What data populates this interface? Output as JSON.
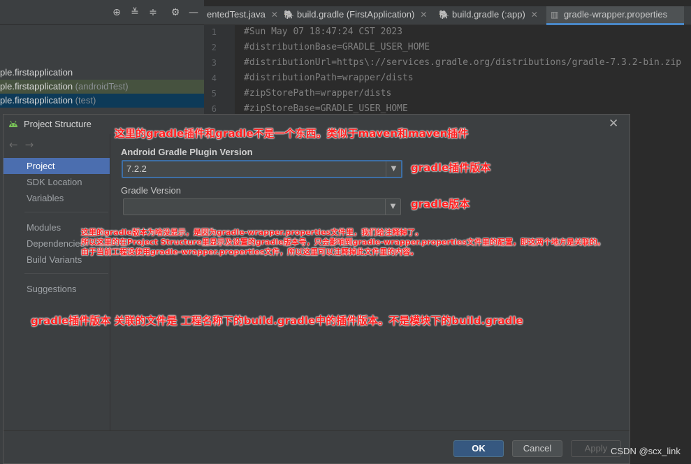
{
  "ide": {
    "toolbar_icons": [
      "crosshair-icon",
      "expand-all-icon",
      "collapse-all-icon",
      "gear-icon",
      "minimize-icon"
    ],
    "tree_rows": [
      {
        "main": "ple.firstapplication",
        "suffix": ""
      },
      {
        "main": "ple.firstapplication",
        "suffix": " (androidTest)"
      },
      {
        "main": "ple.firstapplication",
        "suffix": " (test)"
      }
    ],
    "tabs": [
      {
        "label": "entedTest.java"
      },
      {
        "label": "build.gradle (FirstApplication)"
      },
      {
        "label": "build.gradle (:app)"
      },
      {
        "label": "gradle-wrapper.properties"
      }
    ],
    "editor_lines": [
      {
        "no": "1",
        "text": "#Sun May 07 18:47:24 CST 2023"
      },
      {
        "no": "2",
        "text": "#distributionBase=GRADLE_USER_HOME"
      },
      {
        "no": "3",
        "text": "#distributionUrl=https\\://services.gradle.org/distributions/gradle-7.3.2-bin.zip"
      },
      {
        "no": "4",
        "text": "#distributionPath=wrapper/dists"
      },
      {
        "no": "5",
        "text": "#zipStorePath=wrapper/dists"
      },
      {
        "no": "6",
        "text": "#zipStoreBase=GRADLE_USER_HOME"
      }
    ]
  },
  "dialog": {
    "title": "Project Structure",
    "nav": {
      "items": [
        "Project",
        "SDK Location",
        "Variables",
        "Modules",
        "Dependencies",
        "Build Variants",
        "Suggestions"
      ],
      "selected": "Project"
    },
    "agp_label": "Android Gradle Plugin Version",
    "agp_value": "7.2.2",
    "gradle_label": "Gradle Version",
    "gradle_value": "",
    "buttons": {
      "ok": "OK",
      "cancel": "Cancel",
      "apply": "Apply"
    }
  },
  "annotations": {
    "title_note": "这里的gradle插件和gradle不是一个东西。类似于maven和maven插件",
    "agp_note": "gradle插件版本",
    "gradle_note": "gradle版本",
    "explain_lines": [
      "这里的gradle版本为啥没显示，是因为gradle-wrapper.properties文件里，我们给注释掉了。",
      "所以这里的在Project Structure里显示及设置的gradle版本号，只会影响到gradle-wrapper.properties文件里的配置，即这两个地方是关联的。",
      "由于当前工程没使用gradle-wrapper.properties文件，所以这里可以注释掉此文件里的内容。"
    ],
    "bottom_note": "gradle插件版本 关联的文件是 工程名称下的build.gradle中的插件版本。不是模块下的build.gradle"
  },
  "watermark": "CSDN @scx_link",
  "colors": {
    "selection": "#4b6eaf",
    "annotation": "#ff2020",
    "ok_button": "#365880"
  }
}
